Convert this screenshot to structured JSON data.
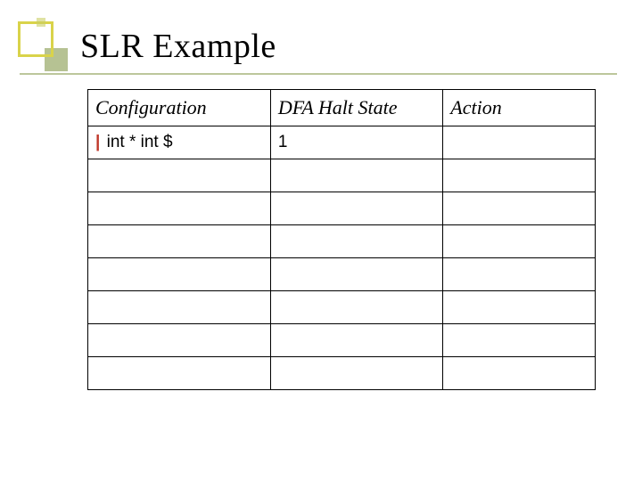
{
  "title": "SLR Example",
  "table": {
    "headers": {
      "config": "Configuration",
      "halt": "DFA Halt State",
      "action": "Action"
    },
    "rows": [
      {
        "config_bar": "|",
        "config_rest": " int * int $",
        "halt": "1",
        "action": ""
      },
      {
        "config_bar": "",
        "config_rest": "",
        "halt": "",
        "action": ""
      },
      {
        "config_bar": "",
        "config_rest": "",
        "halt": "",
        "action": ""
      },
      {
        "config_bar": "",
        "config_rest": "",
        "halt": "",
        "action": ""
      },
      {
        "config_bar": "",
        "config_rest": "",
        "halt": "",
        "action": ""
      },
      {
        "config_bar": "",
        "config_rest": "",
        "halt": "",
        "action": ""
      },
      {
        "config_bar": "",
        "config_rest": "",
        "halt": "",
        "action": ""
      },
      {
        "config_bar": "",
        "config_rest": "",
        "halt": "",
        "action": ""
      }
    ]
  }
}
